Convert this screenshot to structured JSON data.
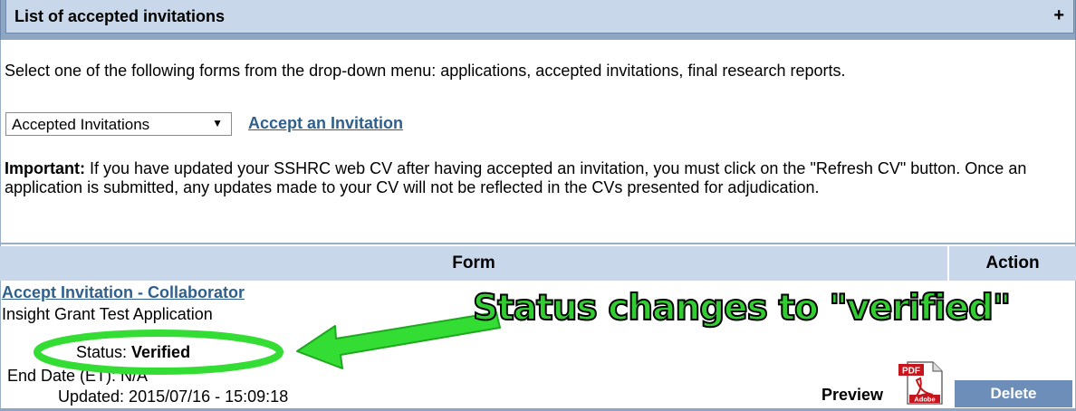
{
  "panel": {
    "title": "List of accepted invitations",
    "toggle_label": "+"
  },
  "intro_text": "Select one of the following forms from the drop-down menu: applications, accepted invitations, final research reports.",
  "form_select": {
    "selected": "Accepted Invitations",
    "arrow": "▼"
  },
  "accept_link": "Accept an Invitation",
  "important": {
    "label": "Important:",
    "text": " If you have updated your SSHRC web CV after having accepted an invitation, you must click on the \"Refresh CV\" button. Once an application is submitted, any updates made to your CV will not be reflected in the CVs presented for adjudication."
  },
  "table": {
    "headers": {
      "form": "Form",
      "action": "Action"
    },
    "row": {
      "title": "Accept Invitation - Collaborator",
      "subtitle": "Insight Grant Test Application",
      "status_label": "Status: ",
      "status_value": "Verified",
      "end_date": "End Date (ET): N/A",
      "updated": "Updated: 2015/07/16 - 15:09:18",
      "preview_label": "Preview",
      "pdf_icon_top": "PDF",
      "pdf_icon_bottom": "Adobe",
      "delete_label": "Delete"
    }
  },
  "annotation": {
    "text": "Status changes to \"verified\"",
    "color": "#33cc33"
  },
  "colors": {
    "header_bg": "#c8d8ea",
    "link": "#2f5f8c",
    "delete_bg": "#6d8eb9"
  }
}
